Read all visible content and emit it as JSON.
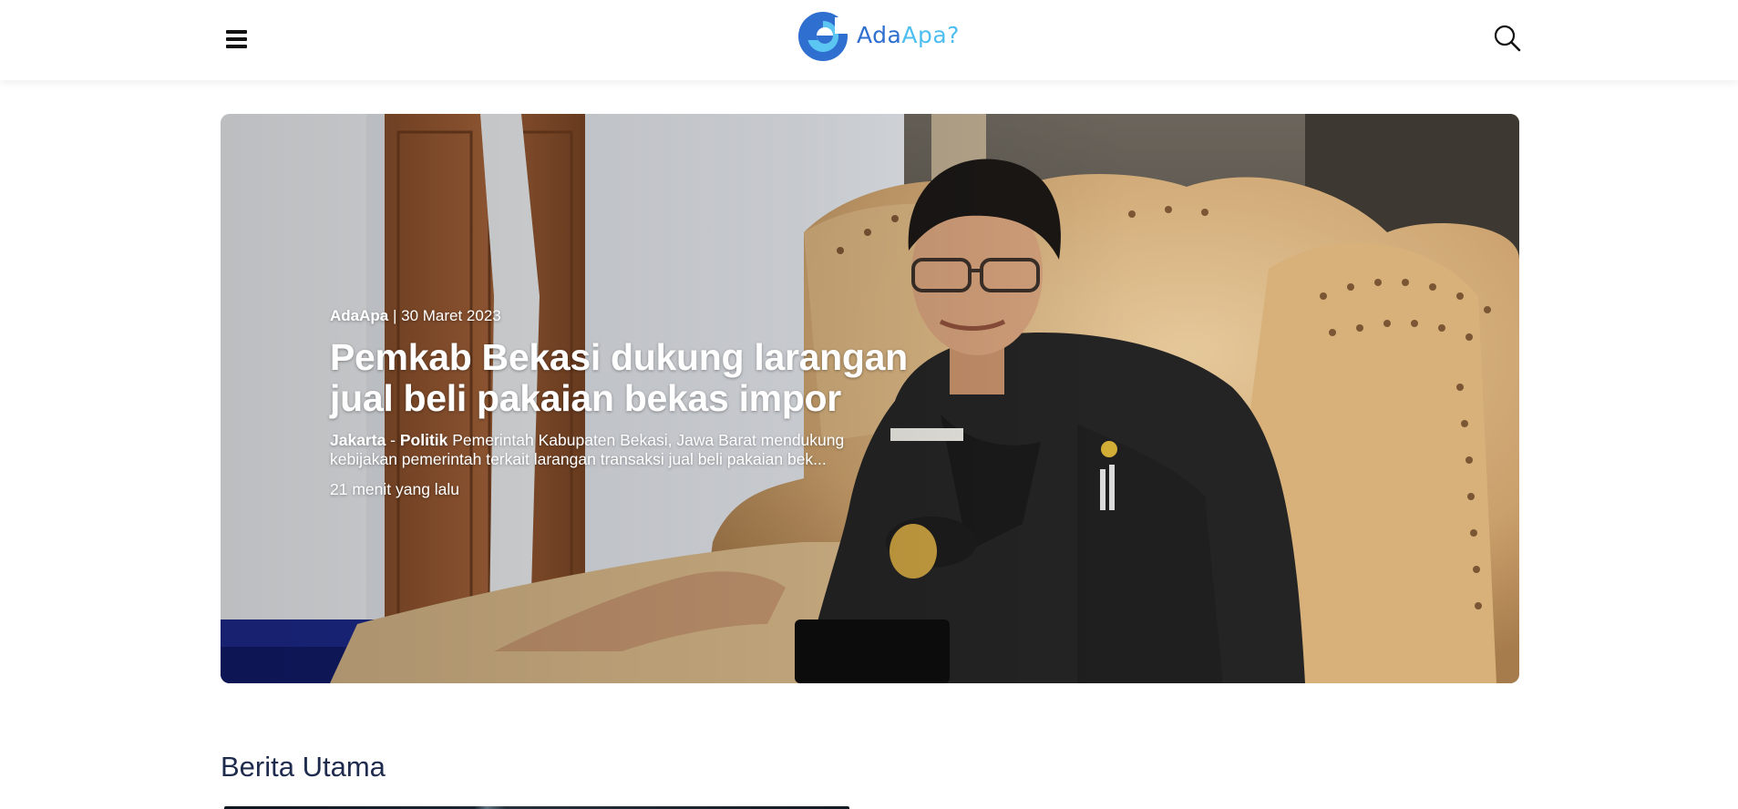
{
  "header": {
    "logo": {
      "part1": "Ada",
      "part2": "Apa?"
    },
    "menu_icon": "hamburger-menu-icon",
    "search_icon": "search-icon"
  },
  "hero": {
    "source": "AdaApa",
    "separator": " | ",
    "date": "30 Maret 2023",
    "title": "Pemkab Bekasi dukung larangan jual beli pakaian bekas impor",
    "location": "Jakarta",
    "dash": " - ",
    "category": "Politik",
    "excerpt": " Pemerintah Kabupaten Bekasi, Jawa Barat mendukung kebijakan pemerintah terkait larangan transaksi jual beli pakaian bek...",
    "time_ago": "21 menit yang lalu"
  },
  "section": {
    "title": "Berita Utama"
  },
  "colors": {
    "brand_dark": "#2f6fd0",
    "brand_light": "#4dbef0",
    "heading": "#1e2b4d"
  }
}
